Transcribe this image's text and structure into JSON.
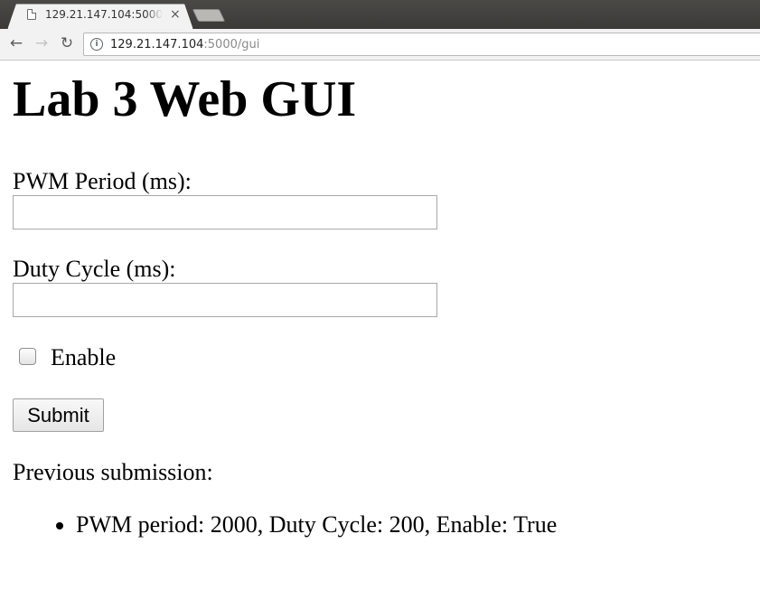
{
  "browser": {
    "tab": {
      "title": "129.21.147.104:5000/gui",
      "close_label": "×"
    },
    "nav": {
      "back_label": "←",
      "forward_label": "→",
      "reload_label": "↻"
    },
    "address": {
      "host": "129.21.147.104",
      "path": ":5000/gui"
    }
  },
  "page": {
    "title": "Lab 3 Web GUI",
    "form": {
      "pwm_period_label": "PWM Period (ms):",
      "pwm_period_value": "",
      "duty_cycle_label": "Duty Cycle (ms):",
      "duty_cycle_value": "",
      "enable_label": "Enable",
      "enable_checked": false,
      "submit_label": "Submit"
    },
    "previous": {
      "heading": "Previous submission:",
      "items": [
        "PWM period: 2000, Duty Cycle: 200, Enable: True"
      ]
    }
  }
}
